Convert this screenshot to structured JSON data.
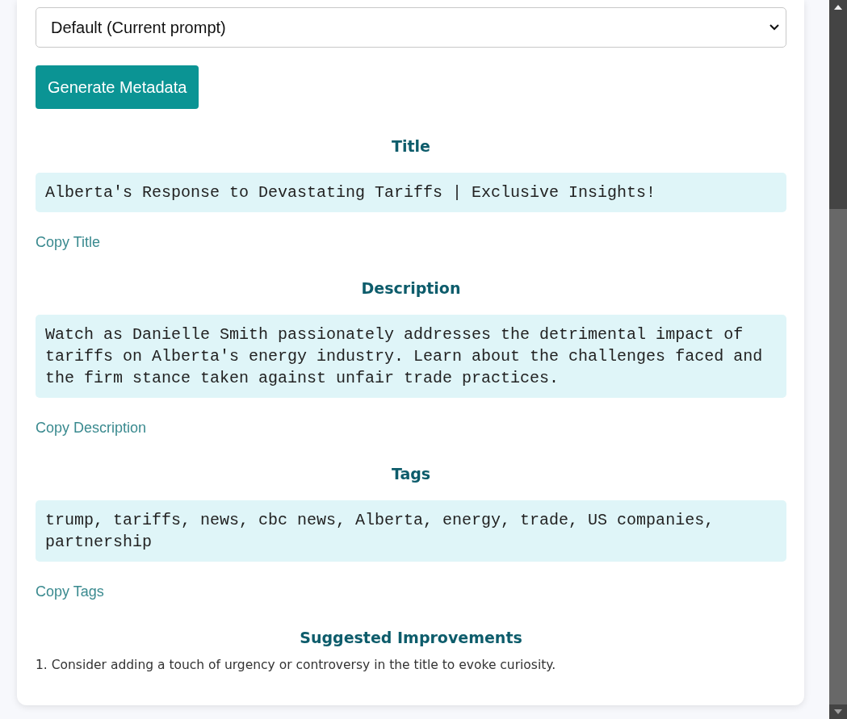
{
  "prompt_select": {
    "value": "Default (Current prompt)"
  },
  "generate_button": {
    "label": "Generate Metadata"
  },
  "sections": [
    {
      "heading": "Title",
      "output": "Alberta's Response to Devastating Tariffs | Exclusive Insights!",
      "copy_label": "Copy Title"
    },
    {
      "heading": "Description",
      "output": "Watch as Danielle Smith passionately addresses the detrimental impact of tariffs on Alberta's energy industry. Learn about the challenges faced and the firm stance taken against unfair trade practices.",
      "copy_label": "Copy Description"
    },
    {
      "heading": "Tags",
      "output": "trump, tariffs, news, cbc news, Alberta, energy, trade, US companies, partnership",
      "copy_label": "Copy Tags"
    }
  ],
  "improvements": {
    "heading": "Suggested Improvements",
    "items": [
      "1. Consider adding a touch of urgency or controversy in the title to evoke curiosity."
    ]
  }
}
